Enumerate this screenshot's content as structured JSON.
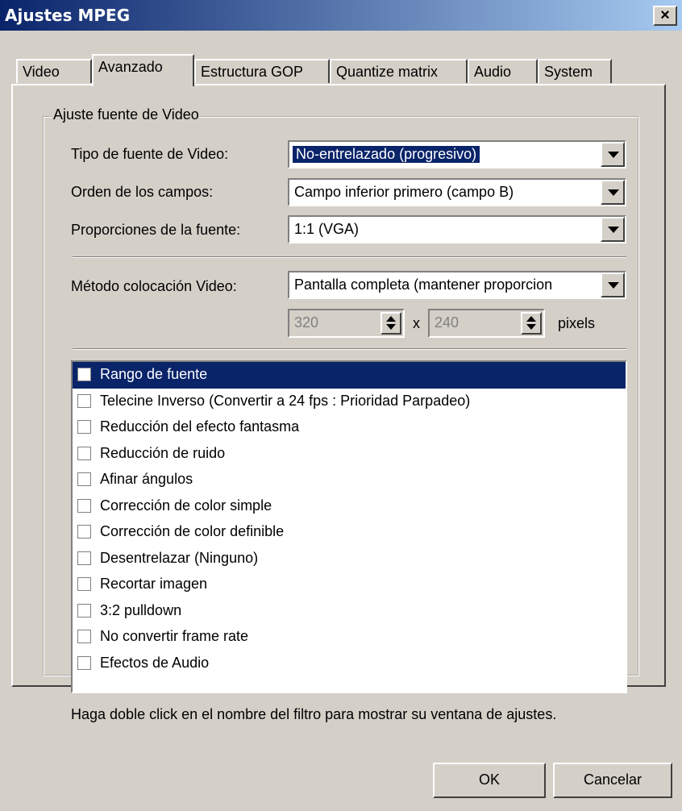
{
  "window": {
    "title": "Ajustes MPEG",
    "close_glyph": "×"
  },
  "tabs": [
    {
      "label": "Video",
      "active": false
    },
    {
      "label": "Avanzado",
      "active": true
    },
    {
      "label": "Estructura GOP",
      "active": false
    },
    {
      "label": "Quantize matrix",
      "active": false
    },
    {
      "label": "Audio",
      "active": false
    },
    {
      "label": "System",
      "active": false
    }
  ],
  "group": {
    "title": "Ajuste fuente de Video",
    "source_type": {
      "label": "Tipo de fuente de Video:",
      "value": "No-entrelazado (progresivo)"
    },
    "field_order": {
      "label": "Orden de los campos:",
      "value": "Campo inferior primero (campo B)"
    },
    "aspect_ratio": {
      "label": "Proporciones de la fuente:",
      "value": "1:1 (VGA)"
    },
    "placement": {
      "label": "Método colocación Video:",
      "value": "Pantalla completa (mantener proporcion"
    },
    "width": {
      "value": "320"
    },
    "times": "x",
    "height": {
      "value": "240"
    },
    "units": "pixels"
  },
  "filters": [
    {
      "label": "Rango de fuente",
      "checked": false,
      "selected": true
    },
    {
      "label": "Telecine Inverso (Convertir a 24 fps : Prioridad Parpadeo)",
      "checked": false
    },
    {
      "label": "Reducción del efecto fantasma",
      "checked": false
    },
    {
      "label": "Reducción de ruido",
      "checked": false
    },
    {
      "label": "Afinar ángulos",
      "checked": false
    },
    {
      "label": "Corrección de color simple",
      "checked": false
    },
    {
      "label": "Corrección de color definible",
      "checked": false
    },
    {
      "label": "Desentrelazar (Ninguno)",
      "checked": false
    },
    {
      "label": "Recortar imagen",
      "checked": false
    },
    {
      "label": "3:2 pulldown",
      "checked": false
    },
    {
      "label": "No convertir frame rate",
      "checked": false
    },
    {
      "label": "Efectos de Audio",
      "checked": false
    }
  ],
  "hint": "Haga doble click en el nombre del filtro para mostrar su ventana de ajustes.",
  "buttons": {
    "ok": "OK",
    "cancel": "Cancelar"
  }
}
